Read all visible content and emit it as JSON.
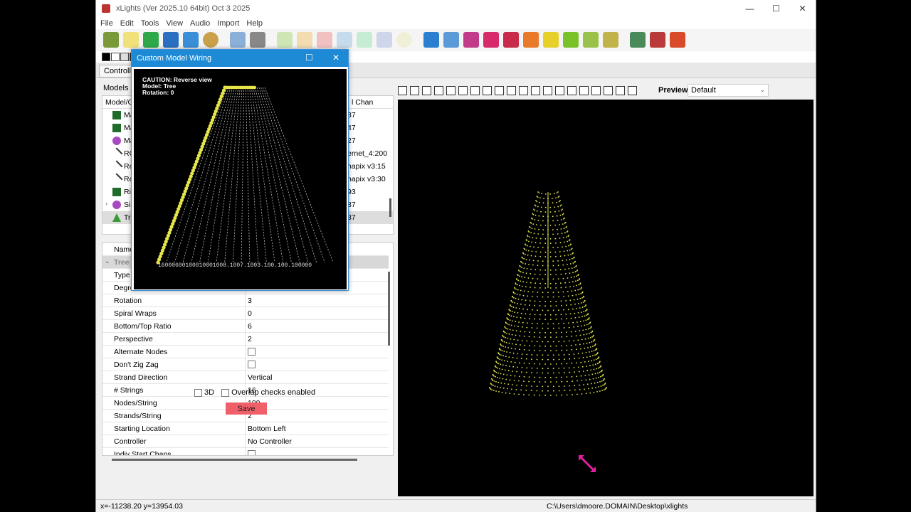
{
  "window": {
    "title": "xLights (Ver 2025.10 64bit) Oct  3 2025",
    "controls": [
      "—",
      "☐",
      "✕"
    ]
  },
  "menu": [
    "File",
    "Edit",
    "Tools",
    "View",
    "Audio",
    "Import",
    "Help"
  ],
  "tabs": {
    "active": "Controlle"
  },
  "models_panel": {
    "label": "Models",
    "header_name": "Model/G",
    "header_chan": "l Chan",
    "rows": [
      {
        "name": "Ma",
        "chan": "87",
        "icon": "matrix-icon"
      },
      {
        "name": "Ma",
        "chan": "47",
        "icon": "matrix-icon"
      },
      {
        "name": "Ma",
        "chan": "27",
        "icon": "star-icon"
      },
      {
        "name": "RG",
        "chan": "ernet_4:200",
        "icon": "line-icon"
      },
      {
        "name": "Re",
        "chan": "hapix v3:15",
        "icon": "line-icon"
      },
      {
        "name": "Re",
        "chan": "hapix v3:30",
        "icon": "line-icon"
      },
      {
        "name": "Rig",
        "chan": "93",
        "icon": "matrix-icon"
      },
      {
        "name": "Sin",
        "chan": "87",
        "icon": "star-icon"
      },
      {
        "name": "Tre",
        "chan": "87",
        "icon": "tree-icon"
      }
    ]
  },
  "properties": {
    "header": "Name",
    "category": "Tree",
    "rows": [
      {
        "name": "Type",
        "value": ""
      },
      {
        "name": "Degree",
        "value": ""
      },
      {
        "name": "Rotation",
        "value": "3"
      },
      {
        "name": "Spiral Wraps",
        "value": "0"
      },
      {
        "name": "Bottom/Top Ratio",
        "value": "6"
      },
      {
        "name": "Perspective",
        "value": "2"
      },
      {
        "name": "Alternate Nodes",
        "value": "",
        "checkbox": true
      },
      {
        "name": "Don't Zig Zag",
        "value": "",
        "checkbox": true
      },
      {
        "name": "Strand Direction",
        "value": "Vertical"
      },
      {
        "name": "# Strings",
        "value": "16"
      },
      {
        "name": "Nodes/String",
        "value": "100"
      },
      {
        "name": "Strands/String",
        "value": "2"
      },
      {
        "name": "Starting Location",
        "value": "Bottom Left"
      },
      {
        "name": "Controller",
        "value": "No Controller"
      },
      {
        "name": "Indiv Start Chans",
        "value": "",
        "checkbox": true
      }
    ]
  },
  "options": {
    "threed_label": "3D",
    "overlap_label": "Overlap checks enabled"
  },
  "save_label": "Save",
  "preview": {
    "label": "Preview:",
    "selected": "Default"
  },
  "status": {
    "coords": "x=-11238.20 y=13954.03",
    "path": "C:\\Users\\dmoore.DOMAIN\\Desktop\\xlights"
  },
  "dialog": {
    "title": "Custom Model Wiring",
    "info_line1": "CAUTION: Reverse view",
    "info_line2": "Model: Tree",
    "info_line3": "Rotation: 0",
    "bottom_text": "16000600100010001008.1007.1003.100.100.100000"
  },
  "colors": {
    "accent": "#1e8ad6",
    "node": "#e6e64a",
    "save": "#f0606a"
  }
}
